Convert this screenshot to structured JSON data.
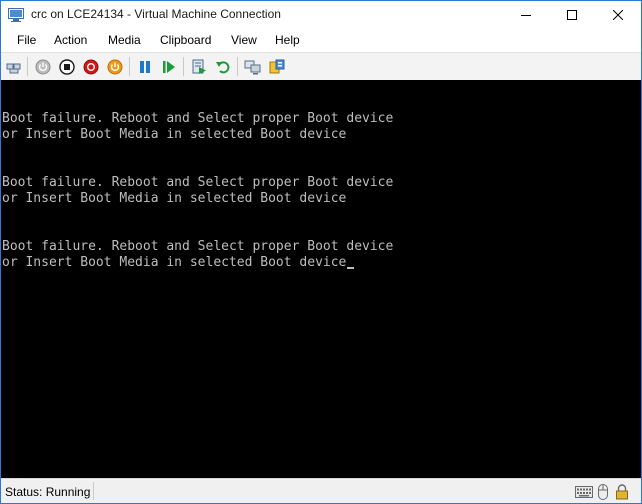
{
  "window": {
    "title": "crc on LCE24134 - Virtual Machine Connection",
    "border_color": "#2b79d6"
  },
  "menu": {
    "items": [
      {
        "label": "File"
      },
      {
        "label": "Action"
      },
      {
        "label": "Media"
      },
      {
        "label": "Clipboard"
      },
      {
        "label": "View"
      },
      {
        "label": "Help"
      }
    ]
  },
  "toolbar": {
    "buttons": [
      {
        "icon": "ctrl-alt-del-icon"
      },
      {
        "icon": "start-icon"
      },
      {
        "icon": "turn-off-icon"
      },
      {
        "icon": "shutdown-icon"
      },
      {
        "icon": "power-icon"
      },
      {
        "icon": "pause-icon"
      },
      {
        "icon": "resume-icon"
      },
      {
        "icon": "checkpoint-icon"
      },
      {
        "icon": "revert-icon"
      },
      {
        "icon": "enhanced-session-icon"
      },
      {
        "icon": "share-icon"
      }
    ]
  },
  "console": {
    "lines": [
      "Boot failure. Reboot and Select proper Boot device",
      "or Insert Boot Media in selected Boot device",
      "Boot failure. Reboot and Select proper Boot device",
      "or Insert Boot Media in selected Boot device",
      "Boot failure. Reboot and Select proper Boot device",
      "or Insert Boot Media in selected Boot device"
    ],
    "text_color": "#bdbdbd",
    "background": "#000000"
  },
  "status": {
    "text": "Status: Running"
  },
  "status_icons": [
    "keyboard-icon",
    "mouse-icon",
    "lock-icon"
  ]
}
